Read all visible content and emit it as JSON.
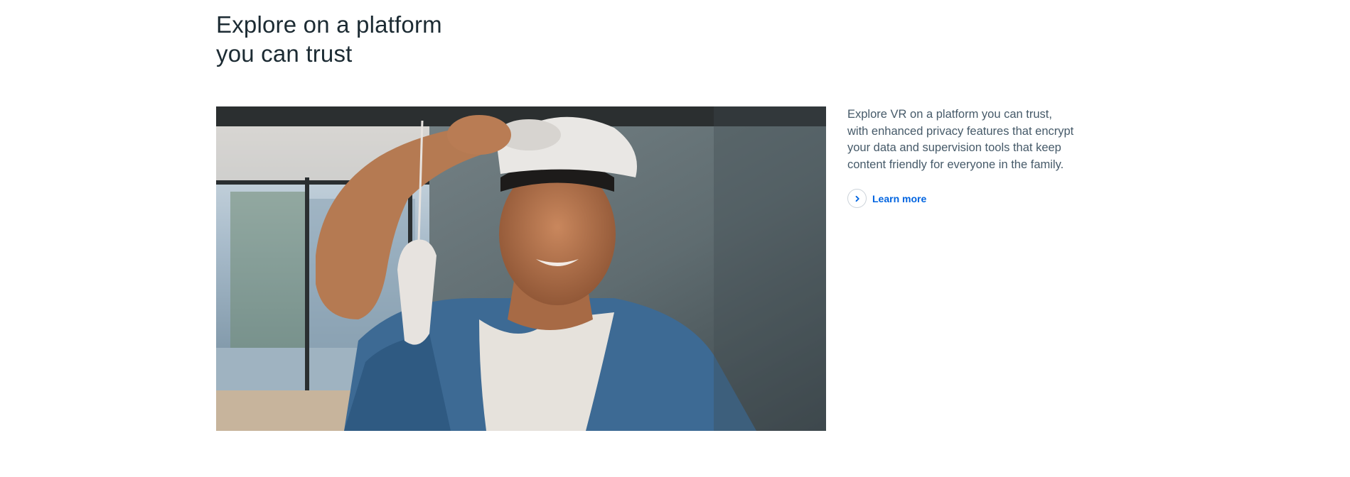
{
  "section": {
    "heading_line1": "Explore on a platform",
    "heading_line2": "you can trust",
    "description": "Explore VR on a platform you can trust, with enhanced privacy features that encrypt your data and supervision tools that keep content friendly for everyone in the family.",
    "learn_more_label": "Learn more",
    "learn_more_icon": "chevron-right-icon",
    "link_color": "#0064e0"
  }
}
